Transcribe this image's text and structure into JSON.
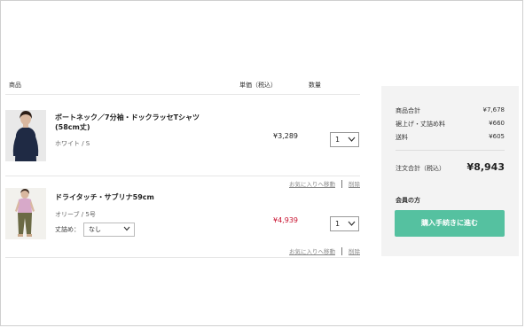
{
  "cart": {
    "header": {
      "product": "商品",
      "price": "単価（税込）",
      "quantity": "数量"
    },
    "items": [
      {
        "name": "ボートネック／7分袖・ドックラッセTシャツ(58cm丈)",
        "variant": "ホワイト / S",
        "price": "¥3,289",
        "quantity": "1",
        "favorite_link": "お気に入りへ移動",
        "delete_link": "削除"
      },
      {
        "name": "ドライタッチ・サブリナ59cm",
        "variant": "オリーブ / 5号",
        "hem_label": "丈詰め：",
        "hem_value": "なし",
        "price": "¥4,939",
        "quantity": "1",
        "favorite_link": "お気に入りへ移動",
        "delete_link": "削除"
      }
    ]
  },
  "summary": {
    "subtotal_label": "商品合計",
    "subtotal_value": "¥7,678",
    "alteration_label": "裾上げ・丈詰め料",
    "alteration_value": "¥660",
    "shipping_label": "送料",
    "shipping_value": "¥605",
    "total_label": "注文合計（税込）",
    "total_value": "¥8,943",
    "member_label": "会員の方",
    "checkout_button": "購入手続きに進む"
  },
  "colors": {
    "sale_price": "#c8102e",
    "checkout_button": "#55c1a0",
    "summary_bg": "#f3f3f3"
  },
  "icons": [
    "chevron-down-icon"
  ]
}
